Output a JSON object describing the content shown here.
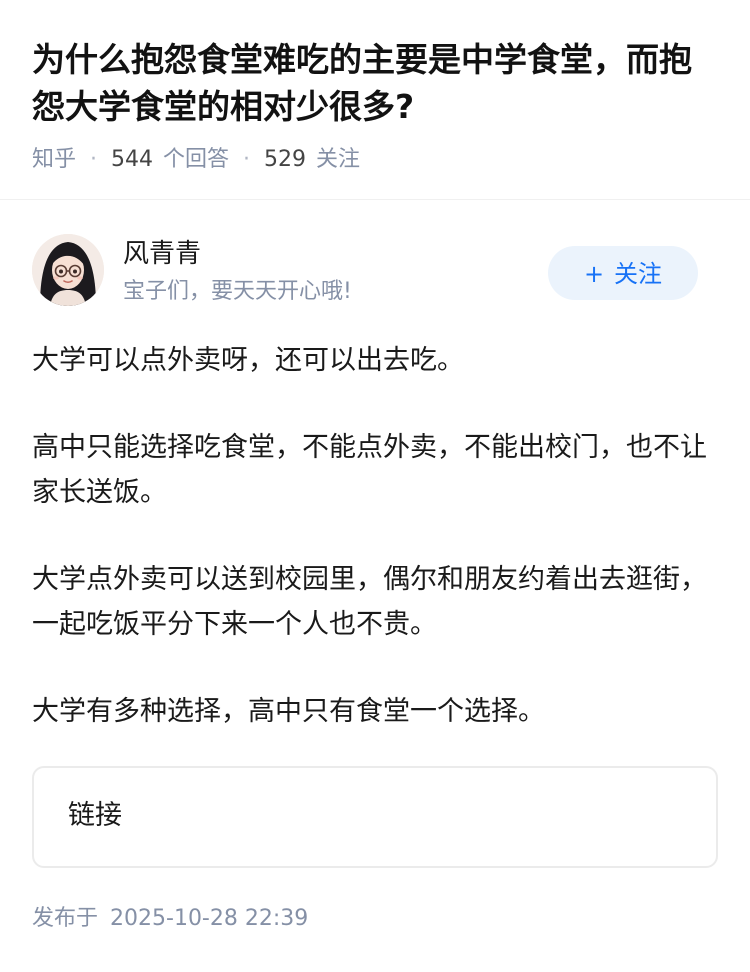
{
  "question": {
    "title": "为什么抱怨食堂难吃的主要是中学食堂，而抱怨大学食堂的相对少很多?",
    "source": "知乎",
    "answers_count": "544",
    "answers_label": "个回答",
    "followers_count": "529",
    "followers_label": "关注"
  },
  "author": {
    "name": "风青青",
    "bio": "宝子们，要天天开心哦!",
    "follow_plus": "+",
    "follow_label": "关注"
  },
  "answer": {
    "paragraphs": [
      "大学可以点外卖呀，还可以出去吃。",
      "高中只能选择吃食堂，不能点外卖，不能出校门，也不让家长送饭。",
      "大学点外卖可以送到校园里，偶尔和朋友约着出去逛街，一起吃饭平分下来一个人也不贵。",
      "大学有多种选择，高中只有食堂一个选择。"
    ]
  },
  "link_card": {
    "label": "链接"
  },
  "footer": {
    "publish_label": "发布于",
    "publish_time": "2025-10-28 22:39"
  },
  "colors": {
    "accent": "#1772f6",
    "follow_bg": "#ebf3fc",
    "meta": "#8590a6"
  }
}
